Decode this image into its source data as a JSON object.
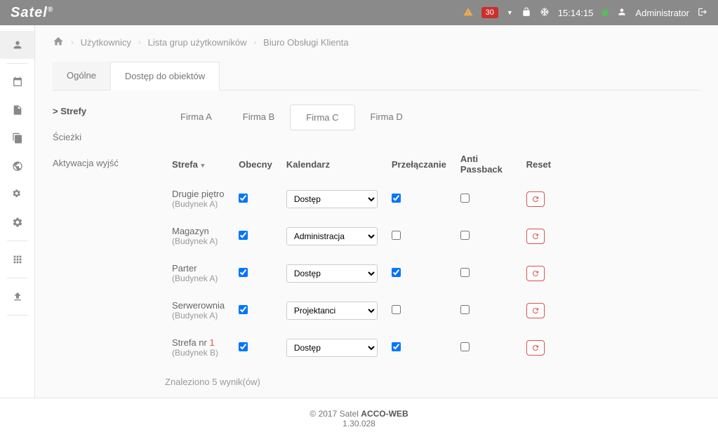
{
  "topbar": {
    "logo": "Satel",
    "badge_count": "30",
    "time": "15:14:15",
    "user": "Administrator"
  },
  "breadcrumb": {
    "items": [
      "Użytkownicy",
      "Lista grup użytkowników",
      "Biuro Obsługi Klienta"
    ]
  },
  "tabs": {
    "items": [
      "Ogólne",
      "Dostęp do obiektów"
    ],
    "active": 1
  },
  "subnav": {
    "items": [
      "Strefy",
      "Ścieżki",
      "Aktywacja wyjść"
    ],
    "active": 0
  },
  "firmtabs": {
    "items": [
      "Firma A",
      "Firma B",
      "Firma C",
      "Firma D"
    ],
    "active": 2
  },
  "table": {
    "headers": {
      "zone": "Strefa",
      "present": "Obecny",
      "calendar": "Kalendarz",
      "toggle": "Przełączanie",
      "anti": "Anti Passback",
      "reset": "Reset"
    },
    "rows": [
      {
        "name": "Drugie piętro",
        "sub": "(Budynek A)",
        "present": true,
        "calendar": "Dostęp",
        "toggle": true,
        "anti": false,
        "number": ""
      },
      {
        "name": "Magazyn",
        "sub": "(Budynek A)",
        "present": true,
        "calendar": "Administracja",
        "toggle": false,
        "anti": false,
        "number": ""
      },
      {
        "name": "Parter",
        "sub": "(Budynek A)",
        "present": true,
        "calendar": "Dostęp",
        "toggle": true,
        "anti": false,
        "number": ""
      },
      {
        "name": "Serwerownia",
        "sub": "(Budynek A)",
        "present": true,
        "calendar": "Projektanci",
        "toggle": false,
        "anti": false,
        "number": ""
      },
      {
        "name": "Strefa nr ",
        "sub": "(Budynek B)",
        "present": true,
        "calendar": "Dostęp",
        "toggle": true,
        "anti": false,
        "number": "1"
      }
    ],
    "calendar_options": [
      "Dostęp",
      "Administracja",
      "Projektanci"
    ]
  },
  "results_text": "Znaleziono 5 wynik(ów)",
  "footer": {
    "copyright": "© 2017 Satel ",
    "product": "ACCO-WEB",
    "version": "1.30.028"
  }
}
